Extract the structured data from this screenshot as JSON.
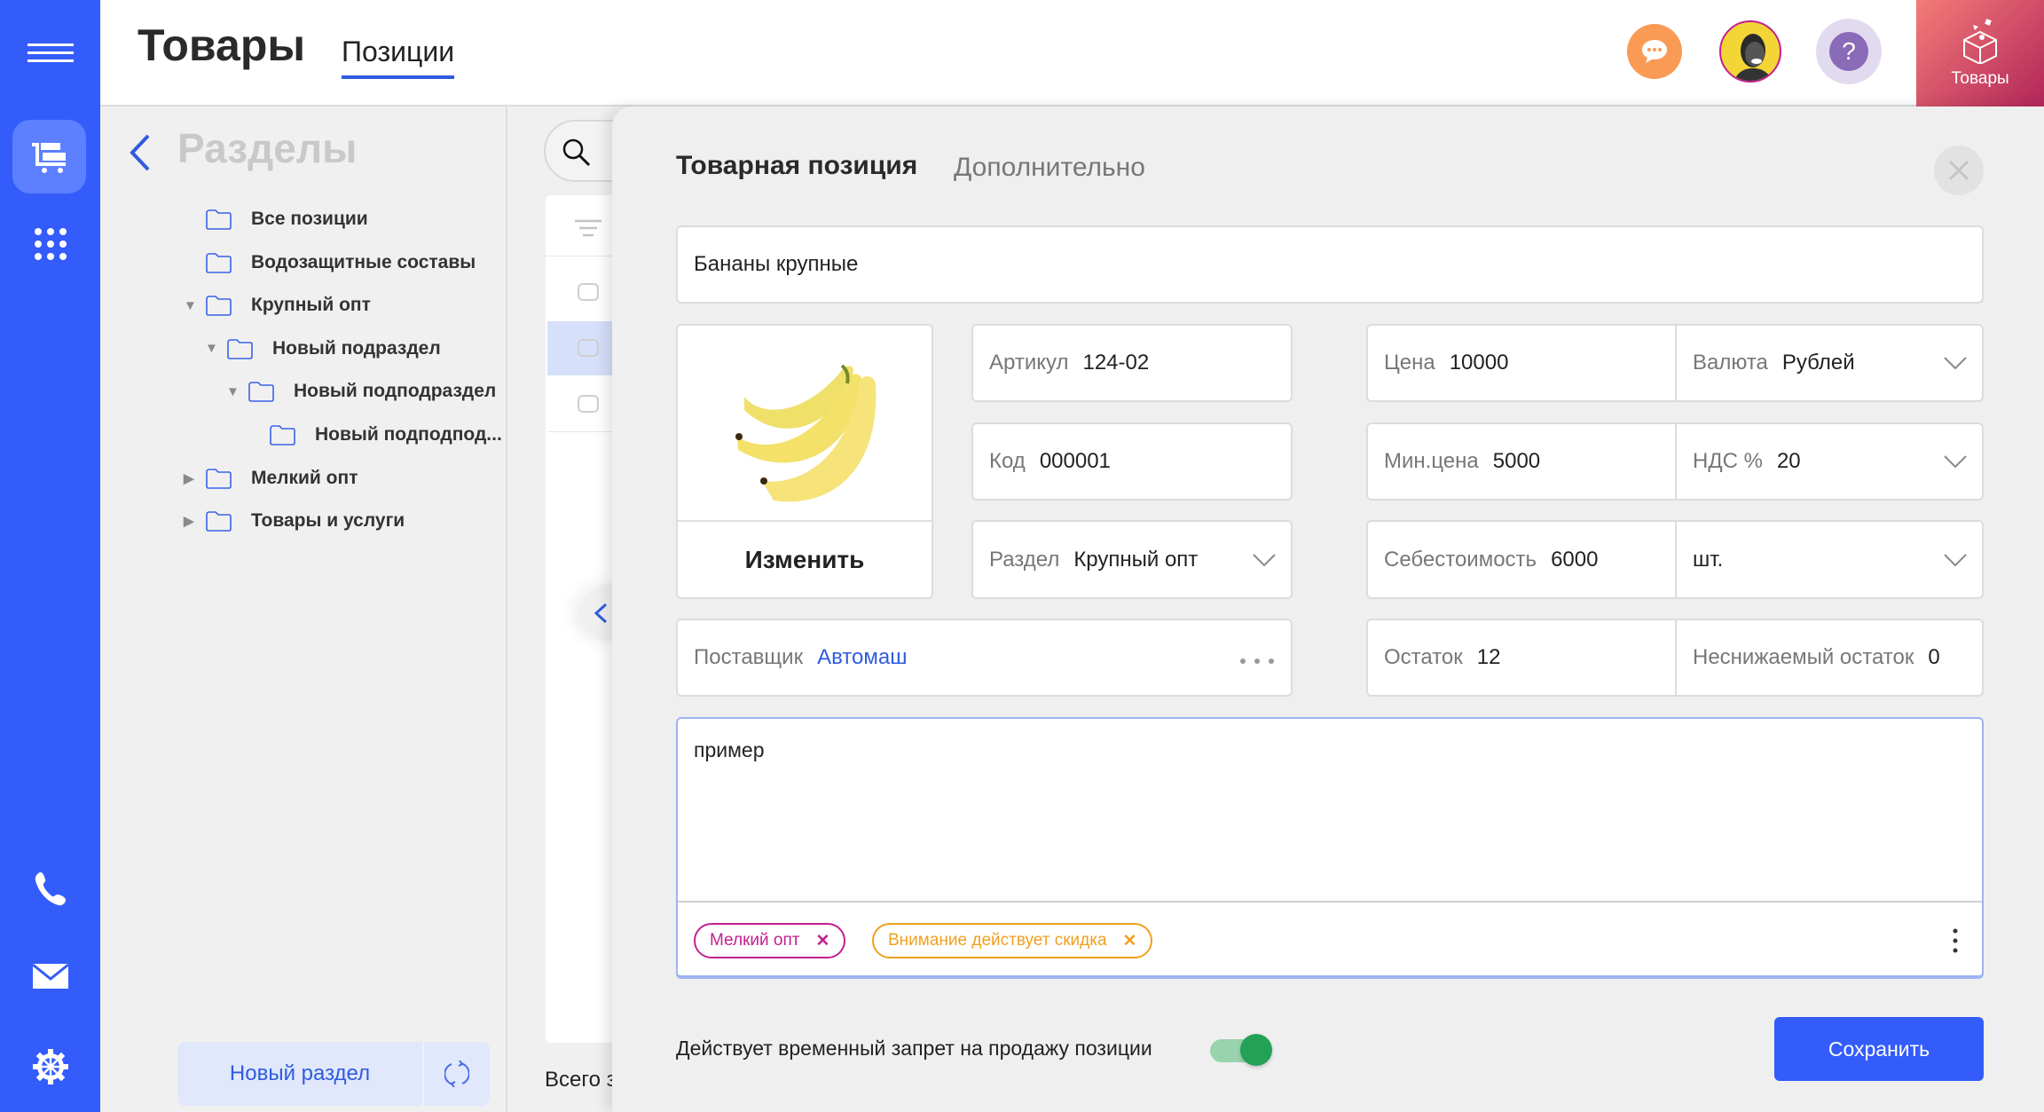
{
  "header": {
    "title": "Товары",
    "tab": "Позиции",
    "module_label": "Товары"
  },
  "sections": {
    "title": "Разделы",
    "items": [
      {
        "label": "Все позиции",
        "level": 0,
        "expander": "none"
      },
      {
        "label": "Водозащитные составы",
        "level": 0,
        "expander": "none"
      },
      {
        "label": "Крупный опт",
        "level": 0,
        "expander": "expanded"
      },
      {
        "label": "Новый подраздел",
        "level": 1,
        "expander": "expanded"
      },
      {
        "label": "Новый подподраздел",
        "level": 2,
        "expander": "expanded"
      },
      {
        "label": "Новый подподпод...",
        "level": 3,
        "expander": "none"
      },
      {
        "label": "Мелкий опт",
        "level": 0,
        "expander": "collapsed"
      },
      {
        "label": "Товары и услуги",
        "level": 0,
        "expander": "collapsed"
      }
    ],
    "new_section_button": "Новый раздел"
  },
  "list": {
    "total_label": "Всего з"
  },
  "modal": {
    "tabs": [
      "Товарная позиция",
      "Дополнительно"
    ],
    "name": "Бананы крупные",
    "change_image": "Изменить",
    "article": {
      "label": "Артикул",
      "value": "124-02"
    },
    "code": {
      "label": "Код",
      "value": "000001"
    },
    "section": {
      "label": "Раздел",
      "value": "Крупный опт"
    },
    "supplier": {
      "label": "Поставщик",
      "value": "Автомаш"
    },
    "price": {
      "label": "Цена",
      "value": "10000"
    },
    "currency": {
      "label": "Валюта",
      "value": "Рублей"
    },
    "min_price": {
      "label": "Мин.цена",
      "value": "5000"
    },
    "vat": {
      "label": "НДС %",
      "value": "20"
    },
    "cost": {
      "label": "Себестоимость",
      "value": "6000"
    },
    "unit": {
      "value": "шт."
    },
    "stock": {
      "label": "Остаток",
      "value": "12"
    },
    "min_stock": {
      "label": "Неснижаемый остаток",
      "value": "0"
    },
    "comment": "пример",
    "tags": [
      {
        "label": "Мелкий опт",
        "color": "#c2208f"
      },
      {
        "label": "Внимание действует скидка",
        "color": "#f0a020"
      }
    ],
    "sale_ban": {
      "label": "Действует временный запрет на продажу позиции",
      "on": true
    },
    "save": "Сохранить"
  },
  "colors": {
    "accent": "#335cfb",
    "toggle": "#22a157",
    "module": "#c8365f"
  }
}
